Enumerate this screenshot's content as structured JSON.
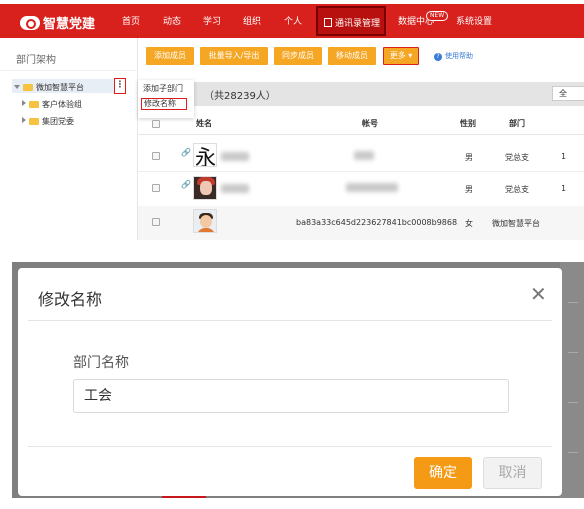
{
  "app": {
    "name": "智慧党建"
  },
  "nav": {
    "items": [
      "首页",
      "动态",
      "学习",
      "组织",
      "个人"
    ],
    "active": "通讯录管理",
    "data_center": "数据中心",
    "data_center_badge": "NEW",
    "settings": "系统设置"
  },
  "sidebar": {
    "title": "部门架构",
    "tree": [
      "微加智慧平台",
      "客户体验组",
      "集团党委"
    ],
    "more_glyph": "⋮"
  },
  "context_menu": {
    "items": [
      "添加子部门",
      "修改名称"
    ]
  },
  "toolbar": {
    "buttons": [
      "添加成员",
      "批量导入/导出",
      "同步成员",
      "移动成员",
      "更多"
    ],
    "help": "使用帮助"
  },
  "list": {
    "count_text": "（共28239人）",
    "right_cut": "全",
    "headers": [
      "姓名",
      "帐号",
      "性别",
      "部门"
    ],
    "rows": [
      {
        "avatar_char": "永",
        "gender": "男",
        "dept": "党总支",
        "extra": "1"
      },
      {
        "gender": "男",
        "dept": "党总支",
        "extra": "1"
      },
      {
        "account": "ba83a33c645d223627841bc0008b9868",
        "gender": "女",
        "dept": "微加智慧平台"
      }
    ]
  },
  "dialog": {
    "title": "修改名称",
    "close_glyph": "✕",
    "field_label": "部门名称",
    "field_value": "工会",
    "ok": "确定",
    "cancel": "取消"
  },
  "colors": {
    "brand_red": "#d8201d",
    "orange": "#f5a623",
    "confirm_orange": "#f59a15"
  }
}
